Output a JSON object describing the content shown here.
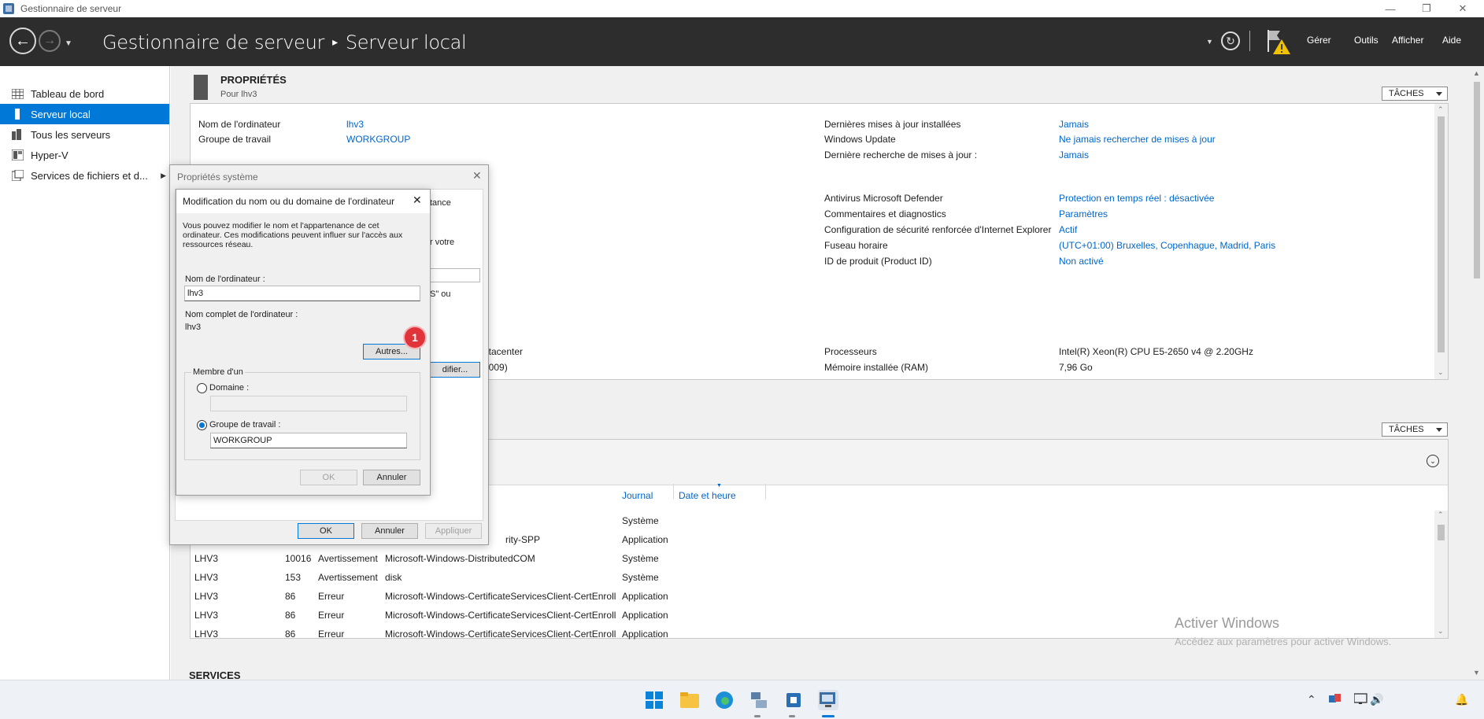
{
  "window": {
    "title": "Gestionnaire de serveur",
    "controls": [
      "—",
      "❐",
      "✕"
    ]
  },
  "header": {
    "app_title": "Gestionnaire de serveur",
    "page_title": "Serveur local",
    "menu": [
      "Gérer",
      "Outils",
      "Afficher",
      "Aide"
    ]
  },
  "sidebar": {
    "items": [
      {
        "label": "Tableau de bord",
        "icon": "dashboard-icon"
      },
      {
        "label": "Serveur local",
        "icon": "server-icon",
        "active": true
      },
      {
        "label": "Tous les serveurs",
        "icon": "servers-icon"
      },
      {
        "label": "Hyper-V",
        "icon": "hyperv-icon"
      },
      {
        "label": "Services de fichiers et d...",
        "icon": "file-services-icon"
      }
    ]
  },
  "properties": {
    "title": "PROPRIÉTÉS",
    "subtitle": "Pour lhv3",
    "tasks_label": "TÂCHES",
    "left": [
      {
        "label": "Nom de l'ordinateur",
        "value": "lhv3"
      },
      {
        "label": "Groupe de travail",
        "value": "WORKGROUP"
      }
    ],
    "right": [
      {
        "label": "Dernières mises à jour installées",
        "value": "Jamais"
      },
      {
        "label": "Windows Update",
        "value": "Ne jamais rechercher de mises à jour"
      },
      {
        "label": "Dernière recherche de mises à jour :",
        "value": "Jamais"
      },
      {
        "label": "Antivirus Microsoft Defender",
        "value": "Protection en temps réel : désactivée"
      },
      {
        "label": "Commentaires et diagnostics",
        "value": "Paramètres"
      },
      {
        "label": "Configuration de sécurité renforcée d'Internet Explorer",
        "value": "Actif"
      },
      {
        "label": "Fuseau horaire",
        "value": "(UTC+01:00) Bruxelles, Copenhague, Madrid, Paris"
      },
      {
        "label": "ID de produit (Product ID)",
        "value": "Non activé"
      },
      {
        "label": "Processeurs",
        "value": "Intel(R) Xeon(R) CPU E5-2650 v4 @ 2.20GHz"
      },
      {
        "label": "Mémoire installée (RAM)",
        "value": "7,96 Go"
      }
    ],
    "partial": [
      "atacenter",
      "2009)"
    ]
  },
  "events": {
    "tasks_label": "TÂCHES",
    "columns": [
      "Journal",
      "Date et heure"
    ],
    "partial_rows": [
      {
        "source": "",
        "journal": "Système"
      },
      {
        "source": "rity-SPP",
        "journal": "Application"
      }
    ],
    "rows": [
      {
        "server": "LHV3",
        "id": "10016",
        "level": "Avertissement",
        "source": "Microsoft-Windows-DistributedCOM",
        "journal": "Système"
      },
      {
        "server": "LHV3",
        "id": "153",
        "level": "Avertissement",
        "source": "disk",
        "journal": "Système"
      },
      {
        "server": "LHV3",
        "id": "86",
        "level": "Erreur",
        "source": "Microsoft-Windows-CertificateServicesClient-CertEnroll",
        "journal": "Application"
      },
      {
        "server": "LHV3",
        "id": "86",
        "level": "Erreur",
        "source": "Microsoft-Windows-CertificateServicesClient-CertEnroll",
        "journal": "Application"
      },
      {
        "server": "LHV3",
        "id": "86",
        "level": "Erreur",
        "source": "Microsoft-Windows-CertificateServicesClient-CertEnroll",
        "journal": "Application"
      }
    ]
  },
  "services": {
    "title": "SERVICES"
  },
  "watermark": {
    "line1": "Activer Windows",
    "line2": "Accédez aux paramètres pour activer Windows."
  },
  "sysprops": {
    "title": "Propriétés système",
    "partial": [
      "tance",
      "r votre",
      "S\" ou",
      "difier..."
    ],
    "ok": "OK",
    "cancel": "Annuler",
    "apply": "Appliquer"
  },
  "rename": {
    "title": "Modification du nom ou du domaine de l'ordinateur",
    "description": "Vous pouvez modifier le nom et l'appartenance de cet ordinateur. Ces modifications peuvent influer sur l'accès aux ressources réseau.",
    "computer_name_label": "Nom de l'ordinateur :",
    "computer_name_value": "lhv3",
    "full_name_label": "Nom complet de l'ordinateur :",
    "full_name_value": "lhv3",
    "others_button": "Autres...",
    "member_of": "Membre d'un",
    "domain_label": "Domaine :",
    "domain_value": "",
    "workgroup_label": "Groupe de travail :",
    "workgroup_value": "WORKGROUP",
    "ok": "OK",
    "cancel": "Annuler",
    "badge": "1"
  },
  "colors": {
    "accent": "#0078d7",
    "header_bg": "#2d2d2d",
    "link": "#0066cc",
    "badge": "#e0333a",
    "warning": "#f2c200"
  }
}
